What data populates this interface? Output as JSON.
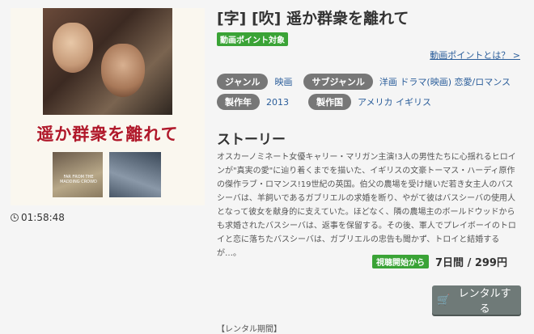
{
  "poster": {
    "title": "遥か群衆を離れて",
    "subtitle": "FAR FROM THE MADDING CROWD"
  },
  "duration": "01:58:48",
  "title": "[字] [吹] 遥か群衆を離れて",
  "point_badge": "動画ポイント対象",
  "point_link": "動画ポイントとは？ >",
  "meta": {
    "genre_label": "ジャンル",
    "genre": "映画",
    "subgenre_label": "サブジャンル",
    "subgenres": "洋画 ドラマ(映画) 恋愛/ロマンス",
    "year_label": "製作年",
    "year": "2013",
    "country_label": "製作国",
    "countries": "アメリカ イギリス"
  },
  "story": {
    "heading": "ストーリー",
    "text": "オスカーノミネート女優キャリー・マリガン主演!3人の男性たちに心揺れるヒロインが\"真実の愛\"に辿り着くまでを描いた、イギリスの文豪トーマス・ハーディ原作の傑作ラブ・ロマンス!19世紀の英国。伯父の農場を受け継いだ若き女主人のバスシーバは、羊飼いであるガブリエルの求婚を断り、やがて彼はバスシーバの使用人となって彼女を献身的に支えていた。ほどなく、隣の農場主のボールドウッドからも求婚されたバスシーバは、返事を保留する。その後、軍人でプレイボーイのトロイと恋に落ちたバスシーバは、ガブリエルの忠告も聞かず、トロイと結婚するが…。"
  },
  "pricing": {
    "badge": "視聴開始から",
    "price": "7日間 / 299円"
  },
  "rent_button": "レンタルする",
  "rental_period": "【レンタル期間】"
}
